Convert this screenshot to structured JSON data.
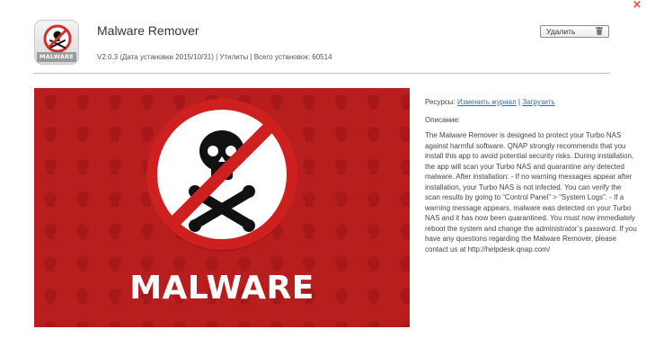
{
  "window": {
    "close_symbol": "×"
  },
  "app": {
    "name": "Malware Remover",
    "icon_label": "MALWARE",
    "meta": "V2.0.3 (Дата установки 2015/10/31) | Утилиты | Всего установок: 60514",
    "remove_label": "Удалить"
  },
  "banner": {
    "text": "MALWARE"
  },
  "resources": {
    "label": "Ресурсы:",
    "changelog_link": "Изменить журнал",
    "separator": "|",
    "download_link": "Загрузить"
  },
  "description": {
    "heading": "Описание:",
    "body": "The Malware Remover is designed to protect your Turbo NAS against harmful software. QNAP strongly recommends that you install this app to avoid potential security risks. During installation, the app will scan your Turbo NAS and quarantine any detected malware. After installation: - If no warning messages appear after installation, your Turbo NAS is not infected. You can verify the scan results by going to “Control Panel” > “System Logs”. - If a warning message appears, malware was detected on your Turbo NAS and it has now been quarantined. You must now immediately reboot the system and change the administrator’s password. If you have any questions regarding the Malware Remover, please contact us at http://helpdesk.qnap.com/"
  },
  "colors": {
    "banner_red": "#b71c1c",
    "link_blue": "#2b6fc0",
    "close_red": "#e8473b"
  },
  "icons": [
    "close-icon",
    "trash-icon",
    "skull-crossbones-icon",
    "prohibition-sign-icon"
  ]
}
